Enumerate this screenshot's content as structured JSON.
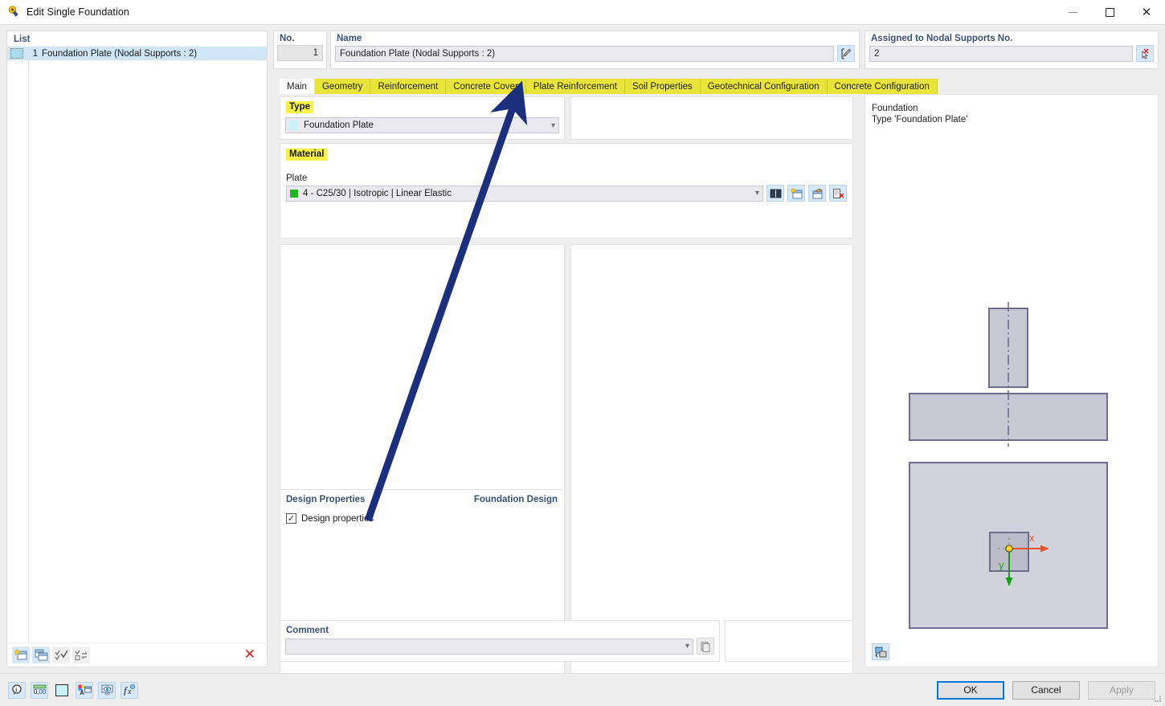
{
  "window": {
    "title": "Edit Single Foundation",
    "app_icon": "foundation-icon",
    "minimize_label": "—",
    "maximize_label": "□",
    "close_label": "✕"
  },
  "left_panel": {
    "header": "List",
    "items": [
      {
        "num": "1",
        "label": "Foundation Plate (Nodal Supports : 2)",
        "selected": true
      }
    ],
    "toolbar": [
      {
        "name": "new-item-button",
        "icon": "new-window-star-icon"
      },
      {
        "name": "copy-item-button",
        "icon": "duplicate-window-icon"
      },
      {
        "name": "select-all-button",
        "icon": "check-all-icon"
      },
      {
        "name": "invert-selection-button",
        "icon": "invert-selection-icon"
      },
      {
        "name": "delete-item-button",
        "icon": "red-x-icon"
      }
    ]
  },
  "header_fields": {
    "no_label": "No.",
    "no_value": "1",
    "name_label": "Name",
    "name_value": "Foundation Plate (Nodal Supports : 2)",
    "name_edit_icon": "edit-pencil-icon",
    "assigned_label": "Assigned to Nodal Supports No.",
    "assigned_value": "2",
    "assigned_pick_icon": "pick-with-cursor-icon"
  },
  "tabs": [
    {
      "label": "Main",
      "active": true
    },
    {
      "label": "Geometry",
      "active": false
    },
    {
      "label": "Reinforcement",
      "active": false
    },
    {
      "label": "Concrete Cover",
      "active": false
    },
    {
      "label": "Plate Reinforcement",
      "active": false
    },
    {
      "label": "Soil Properties",
      "active": false
    },
    {
      "label": "Geotechnical Configuration",
      "active": false
    },
    {
      "label": "Concrete Configuration",
      "active": false
    }
  ],
  "main_tab": {
    "type_section_label": "Type",
    "type_value": "Foundation Plate",
    "material_section_label": "Material",
    "plate_label": "Plate",
    "plate_material_value": "4 - C25/30 | Isotropic | Linear Elastic",
    "material_buttons": [
      {
        "name": "material-library-button",
        "icon": "book-library-icon"
      },
      {
        "name": "material-new-button",
        "icon": "new-material-star-icon"
      },
      {
        "name": "material-import-button",
        "icon": "import-material-icon"
      },
      {
        "name": "material-delete-button",
        "icon": "delete-material-icon"
      }
    ],
    "design_properties_heading": "Design Properties",
    "foundation_design_heading": "Foundation Design",
    "design_properties_checkbox_label": "Design properties",
    "design_properties_checked": true,
    "comment_label": "Comment",
    "comment_value": "",
    "comment_copy_icon": "copy-comment-icon"
  },
  "preview": {
    "line1": "Foundation",
    "line2": "Type 'Foundation Plate'",
    "axis_x_label": "x",
    "axis_y_label": "y",
    "render_button_icon": "render-settings-icon",
    "colors": {
      "fill": "#c9c9d4",
      "stroke": "#6e6e8c",
      "axis_x": "#e2562a",
      "axis_y": "#14a014",
      "node": "#ffdd00"
    }
  },
  "status_bar": {
    "icons": [
      {
        "name": "info-help-icon"
      },
      {
        "name": "number-format-icon"
      },
      {
        "name": "color-swatch-icon"
      },
      {
        "name": "display-properties-icon"
      },
      {
        "name": "view-settings-icon"
      },
      {
        "name": "formula-icon"
      }
    ]
  },
  "dialog_buttons": {
    "ok": "OK",
    "cancel": "Cancel",
    "apply": "Apply",
    "apply_disabled": true
  },
  "annotation": {
    "arrow_color": "#1c2f7c",
    "points_to_tab": "Plate Reinforcement"
  }
}
